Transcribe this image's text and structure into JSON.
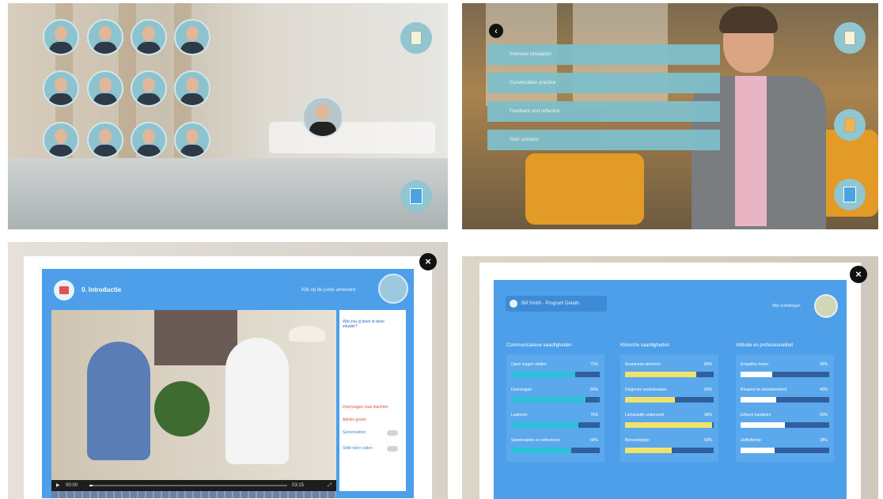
{
  "panel1": {
    "avatars": [
      "team-member-1",
      "team-member-2",
      "team-member-3",
      "team-member-4",
      "team-member-5",
      "team-member-6",
      "team-member-7",
      "team-member-8",
      "team-member-9",
      "team-member-10",
      "team-member-11",
      "team-member-12"
    ],
    "icons": [
      "document-icon",
      "book-icon"
    ],
    "accent": "#8fc6cf"
  },
  "panel2": {
    "menu_items": [
      "Interview simulation",
      "Conversation practice",
      "Feedback and reflection",
      "Start scenario"
    ],
    "icons": [
      "back-icon",
      "document-icon",
      "box-icon",
      "book-icon"
    ]
  },
  "panel3": {
    "title": "0. Introductie",
    "hint": "Klik op de juiste antwoord",
    "close": "×",
    "player": {
      "play": "▶",
      "time": "00:00",
      "end": "03:15",
      "fullscreen": "⤢"
    },
    "side": {
      "question": "Wat zou jij doen in deze situatie?",
      "options_red": [
        "Doorvragen naar klachten",
        "Advies geven"
      ],
      "options_blue": [
        "Samenvatten",
        "Stilte laten vallen"
      ]
    },
    "accent": "#4d9fe9"
  },
  "panel4": {
    "user": "Bill Smith · Program Details",
    "settings": "Mijn instellingen",
    "close": "×",
    "columns": [
      {
        "header": "Communicatieve vaardigheden",
        "color": "#2bc2d8",
        "stats": [
          {
            "label": "Open vragen stellen",
            "pct": "72%",
            "value": 0.72
          },
          {
            "label": "Doorvragen",
            "pct": "84%",
            "value": 0.84
          },
          {
            "label": "Luisteren",
            "pct": "76%",
            "value": 0.76
          },
          {
            "label": "Samenvatten en reflecteren",
            "pct": "68%",
            "value": 0.68
          }
        ]
      },
      {
        "header": "Klinische vaardigheden",
        "color": "#f0e36a",
        "stats": [
          {
            "label": "Anamnese afnemen",
            "pct": "80%",
            "value": 0.8
          },
          {
            "label": "Diagnose onderbouwen",
            "pct": "56%",
            "value": 0.56
          },
          {
            "label": "Lichamelijk onderzoek",
            "pct": "98%",
            "value": 0.98
          },
          {
            "label": "Behandelplan",
            "pct": "53%",
            "value": 0.53
          }
        ]
      },
      {
        "header": "Attitude en professionaliteit",
        "color": "#ffffff",
        "stats": [
          {
            "label": "Empathie tonen",
            "pct": "36%",
            "value": 0.36
          },
          {
            "label": "Respect en betrokkenheid",
            "pct": "40%",
            "value": 0.4
          },
          {
            "label": "Ethisch handelen",
            "pct": "50%",
            "value": 0.5
          },
          {
            "label": "Zelfreflectie",
            "pct": "38%",
            "value": 0.38
          }
        ]
      }
    ]
  }
}
